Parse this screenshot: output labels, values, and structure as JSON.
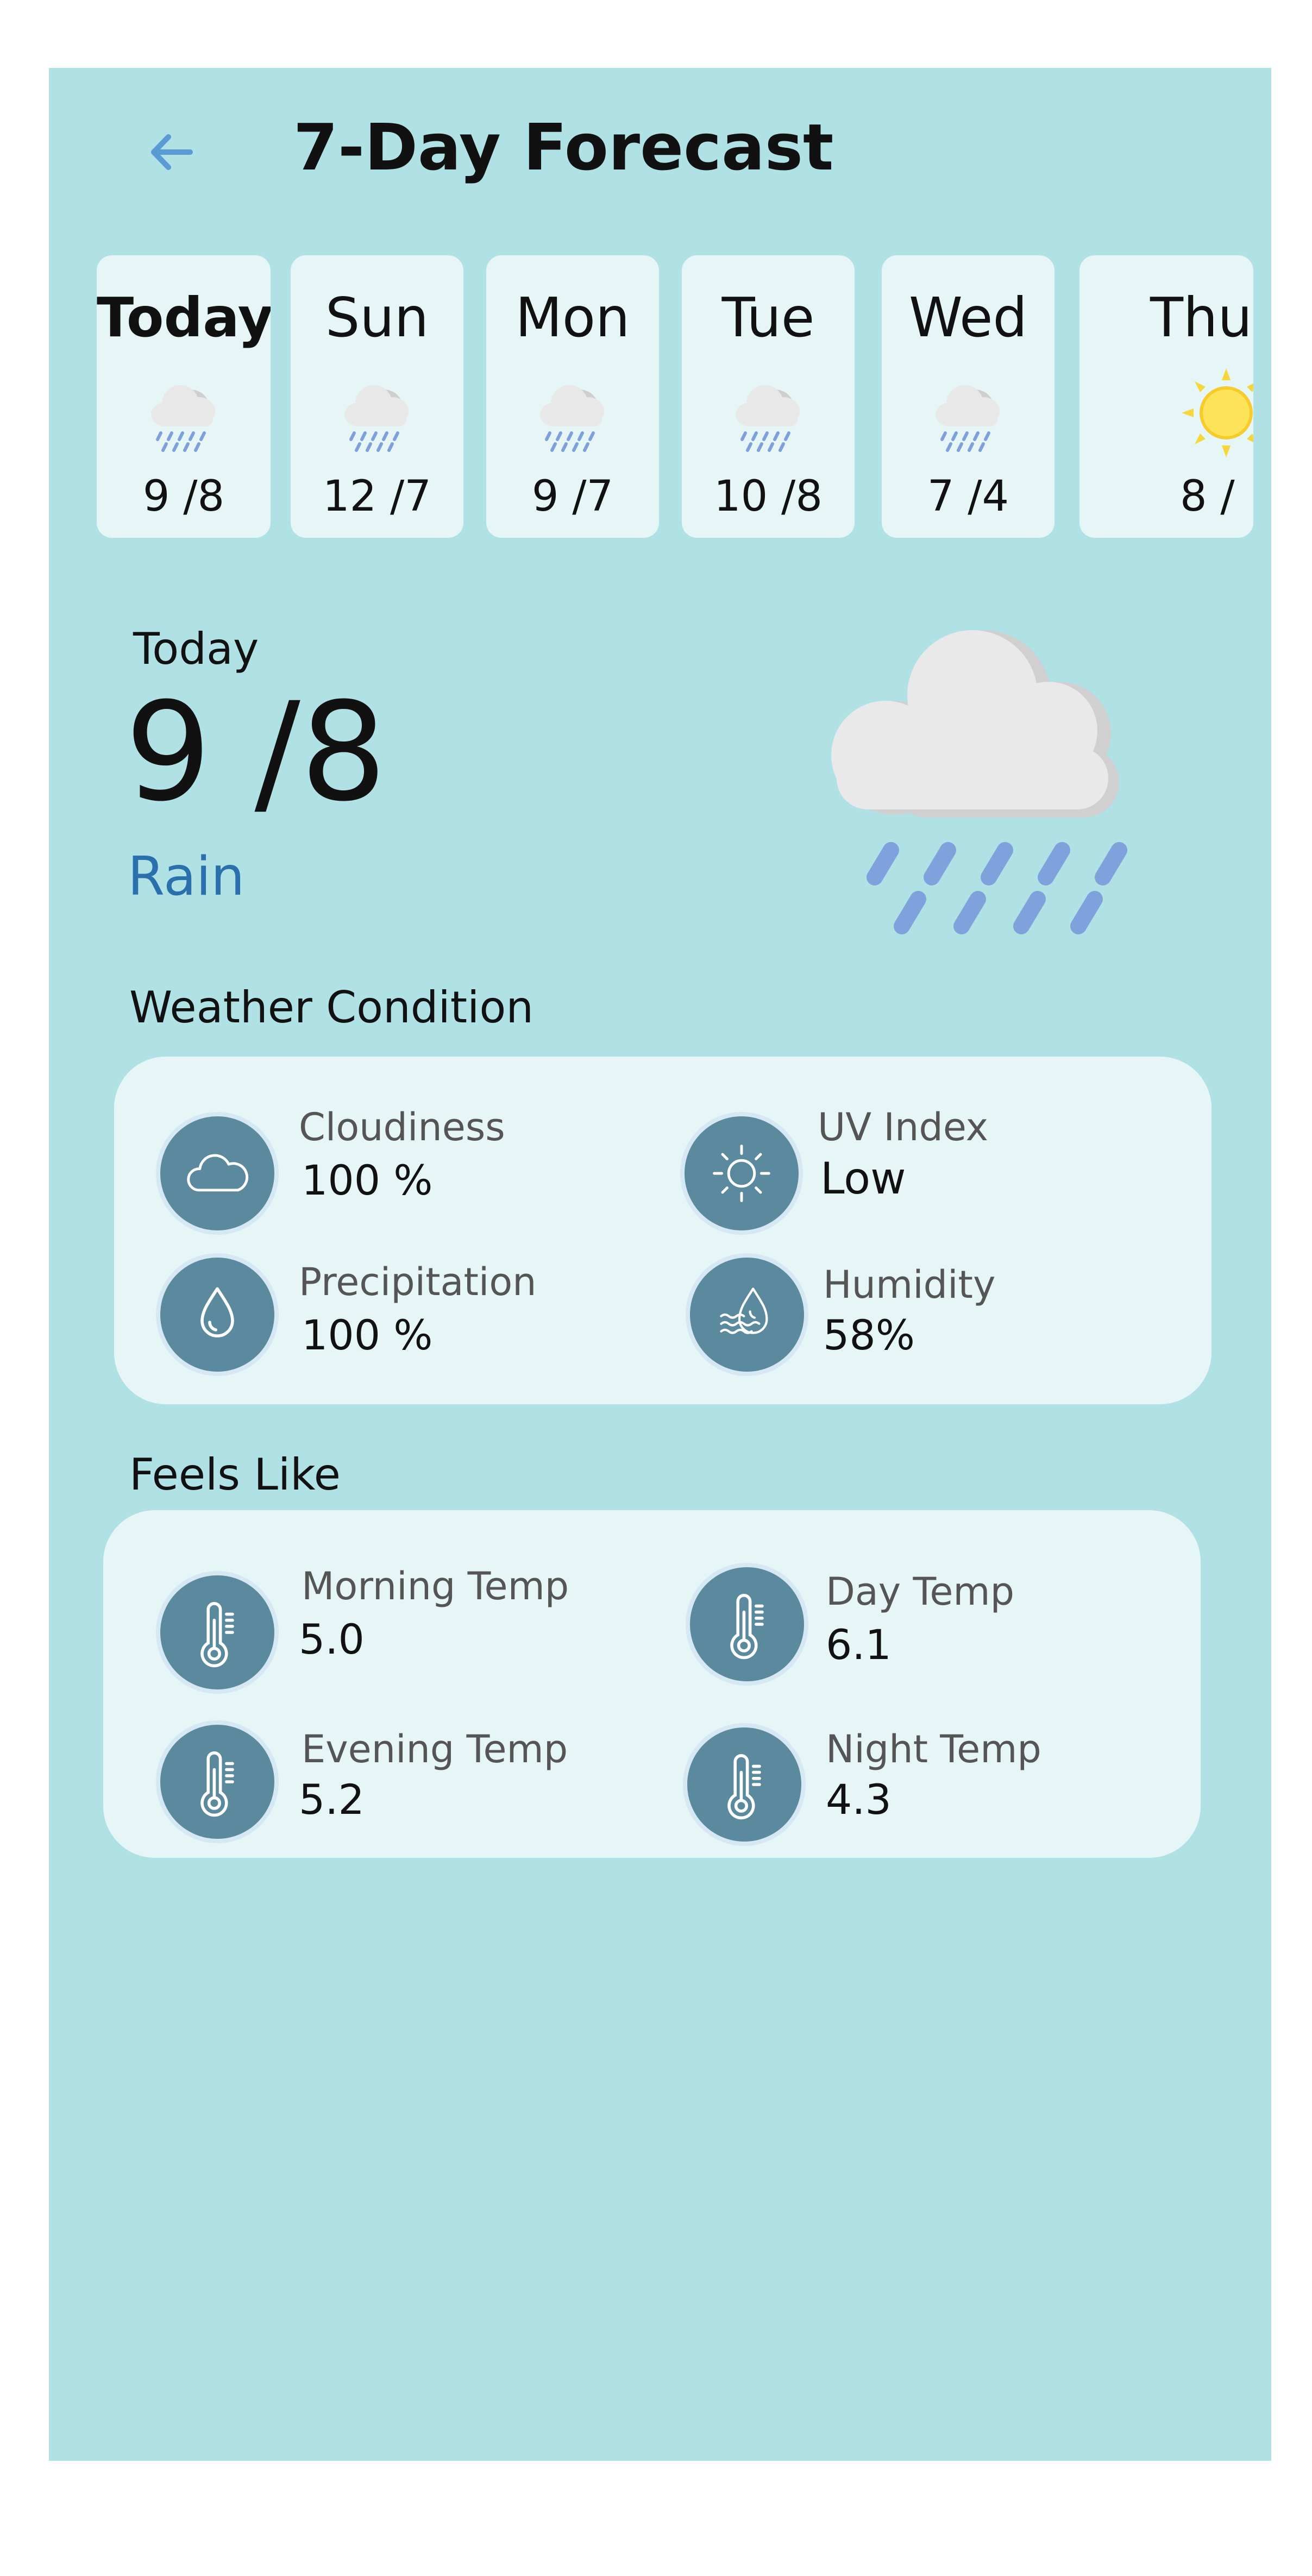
{
  "header": {
    "title": "7-Day Forecast",
    "back_icon": "arrow-left-icon"
  },
  "days": [
    {
      "name": "Today",
      "temp": "9 /8",
      "icon": "rain-cloud-icon"
    },
    {
      "name": "Sun",
      "temp": "12 /7",
      "icon": "rain-cloud-icon"
    },
    {
      "name": "Mon",
      "temp": "9 /7",
      "icon": "rain-cloud-icon"
    },
    {
      "name": "Tue",
      "temp": "10 /8",
      "icon": "rain-cloud-icon"
    },
    {
      "name": "Wed",
      "temp": "7 /4",
      "icon": "rain-cloud-icon"
    },
    {
      "name": "Thu",
      "temp": "8 /",
      "icon": "sun-icon"
    }
  ],
  "today": {
    "label": "Today",
    "temp": "9 /8",
    "condition": "Rain",
    "icon": "rain-cloud-icon"
  },
  "weather_condition": {
    "title": "Weather Condition",
    "items": [
      {
        "label": "Cloudiness",
        "value": "100 %",
        "icon": "cloud-icon"
      },
      {
        "label": "UV Index",
        "value": "Low",
        "icon": "sun-icon"
      },
      {
        "label": "Precipitation",
        "value": "100 %",
        "icon": "water-drop-icon"
      },
      {
        "label": "Humidity",
        "value": "58%",
        "icon": "humidity-icon"
      }
    ]
  },
  "feels_like": {
    "title": "Feels Like",
    "items": [
      {
        "label": "Morning Temp",
        "value": "5.0",
        "icon": "thermometer-icon"
      },
      {
        "label": "Day Temp",
        "value": "6.1",
        "icon": "thermometer-icon"
      },
      {
        "label": "Evening Temp",
        "value": "5.2",
        "icon": "thermometer-icon"
      },
      {
        "label": "Night Temp",
        "value": "4.3",
        "icon": "thermometer-icon"
      }
    ]
  },
  "colors": {
    "background": "#b0e1e4",
    "card": "#e6f5f6",
    "accent_blue": "#2a70ad",
    "icon_circle": "#5b8a9e",
    "back_arrow": "#5b9bd5"
  }
}
